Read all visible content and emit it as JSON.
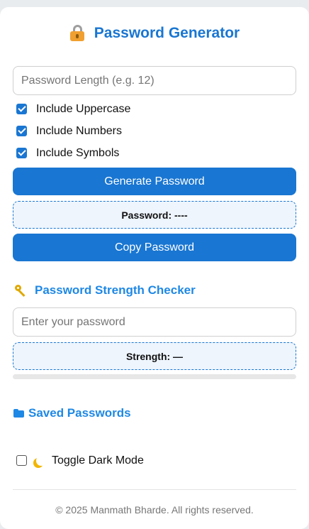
{
  "app": {
    "title": "Password Generator"
  },
  "generator": {
    "length_placeholder": "Password Length (e.g. 12)",
    "length_value": "",
    "options": [
      {
        "label": "Include Uppercase",
        "checked": true
      },
      {
        "label": "Include Numbers",
        "checked": true
      },
      {
        "label": "Include Symbols",
        "checked": true
      }
    ],
    "generate_label": "Generate Password",
    "result_text": "Password: ----",
    "copy_label": "Copy Password"
  },
  "strength": {
    "title": "Password Strength Checker",
    "input_placeholder": "Enter your password",
    "input_value": "",
    "result_text": "Strength: —",
    "level": 0
  },
  "saved": {
    "title": "Saved Passwords",
    "items": []
  },
  "dark_mode": {
    "label": "Toggle Dark Mode",
    "checked": false
  },
  "footer": {
    "text": "© 2025 Manmath Bharde. All rights reserved."
  },
  "colors": {
    "accent": "#1976d2",
    "section_title": "#1e88e5",
    "result_bg": "#eef5fd"
  },
  "icons": {
    "title": "lock-icon",
    "strength": "key-icon",
    "saved": "folder-icon",
    "dark_mode": "moon-icon"
  }
}
